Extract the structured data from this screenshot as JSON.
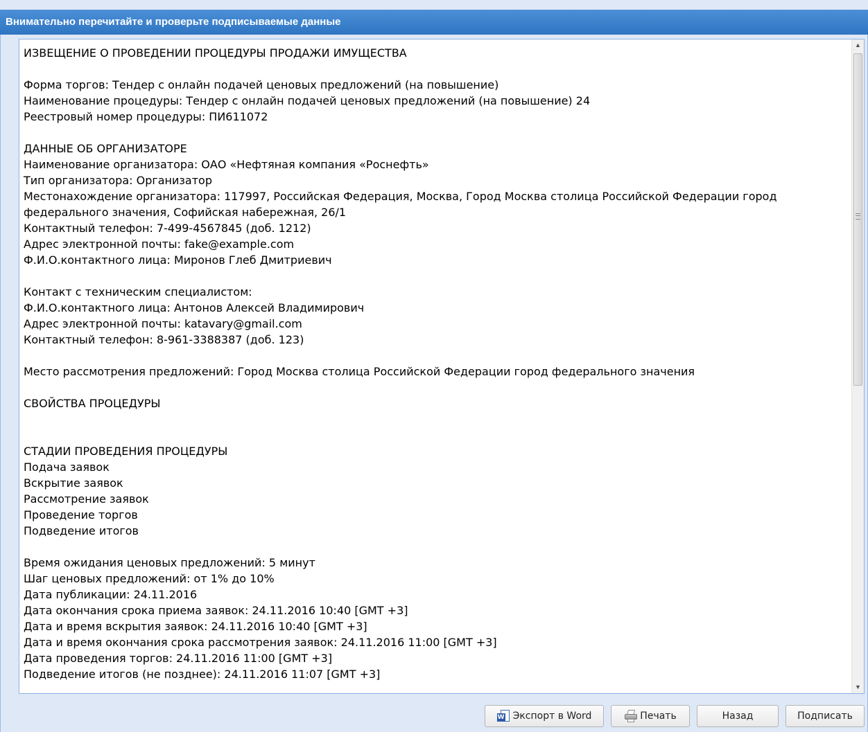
{
  "window": {
    "title": "Внимательно перечитайте и проверьте подписываемые данные"
  },
  "document": {
    "lines": [
      "ИЗВЕЩЕНИЕ О ПРОВЕДЕНИИ ПРОЦЕДУРЫ ПРОДАЖИ ИМУЩЕСТВА",
      "",
      "Форма торгов: Тендер с онлайн подачей ценовых предложений (на повышение)",
      "Наименование процедуры: Тендер с онлайн подачей ценовых предложений (на повышение) 24",
      "Реестровый номер процедуры: ПИ611072",
      "",
      "ДАННЫЕ ОБ ОРГАНИЗАТОРЕ",
      "Наименование организатора: ОАО «Нефтяная компания «Роснефть»",
      "Тип организатора: Организатор",
      "Местонахождение организатора: 117997, Российская Федерация, Москва, Город Москва столица Российской Федерации город федерального значения, Софийская набережная, 26/1",
      "Контактный телефон: 7-499-4567845 (доб. 1212)",
      "Адрес электронной почты: fake@example.com",
      "Ф.И.О.контактного лица: Миронов Глеб Дмитриевич",
      "",
      "Контакт с техническим специалистом:",
      "Ф.И.О.контактного лица: Антонов Алексей Владимирович",
      "Адрес электронной почты: katavary@gmail.com",
      "Контактный телефон: 8-961-3388387 (доб. 123)",
      "",
      "Место рассмотрения предложений: Город Москва столица Российской Федерации город федерального значения",
      "",
      "СВОЙСТВА ПРОЦЕДУРЫ",
      "",
      "",
      "СТАДИИ ПРОВЕДЕНИЯ ПРОЦЕДУРЫ",
      "Подача заявок",
      "Вскрытие заявок",
      "Рассмотрение заявок",
      "Проведение торгов",
      "Подведение итогов",
      "",
      "Время ожидания ценовых предложений: 5 минут",
      "Шаг ценовых предложений: от 1% до 10%",
      "Дата публикации: 24.11.2016",
      "Дата окончания срока приема заявок: 24.11.2016 10:40 [GMT +3]",
      "Дата и время вскрытия заявок: 24.11.2016 10:40 [GMT +3]",
      "Дата и время окончания срока рассмотрения заявок: 24.11.2016 11:00 [GMT +3]",
      "Дата проведения торгов: 24.11.2016 11:00 [GMT +3]",
      "Подведение итогов (не позднее): 24.11.2016 11:07 [GMT +3]"
    ]
  },
  "buttons": {
    "export_label": "Экспорт в Word",
    "print_label": "Печать",
    "back_label": "Назад",
    "sign_label": "Подписать"
  },
  "icons": {
    "export": "word-document-icon",
    "print": "printer-icon",
    "scroll_up": "scroll-up-arrow-icon",
    "scroll_down": "scroll-down-arrow-icon"
  },
  "colors": {
    "titlebar": "#3a82cc",
    "panel_bg": "#dfe8f6",
    "border": "#99bbe8"
  }
}
